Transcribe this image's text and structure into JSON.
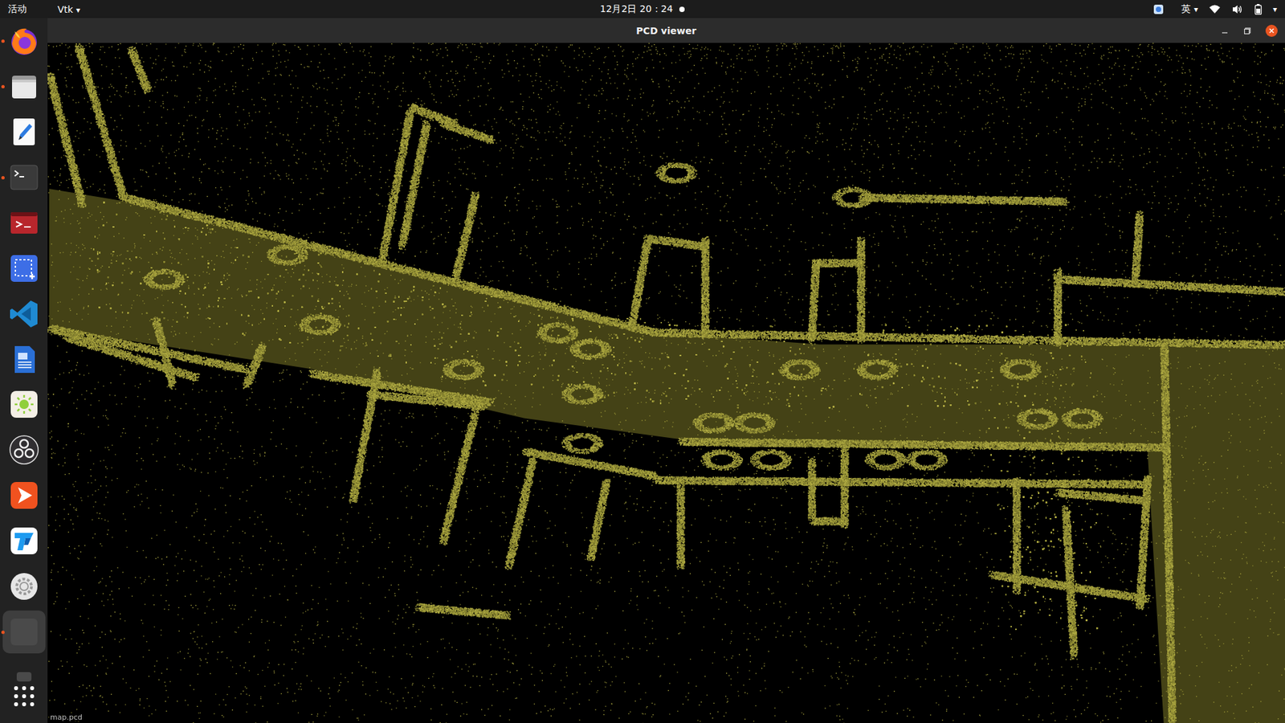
{
  "top_bar": {
    "activities": "活动",
    "app_menu": {
      "label": "Vtk",
      "arrow": "▾"
    },
    "clock": "12月2日 20：24",
    "notification": true,
    "input_method": {
      "label": "英",
      "arrow": "▾"
    },
    "system_arrow": "▾"
  },
  "dock": {
    "items": [
      {
        "kind": "firefox",
        "running": true,
        "selected": false
      },
      {
        "kind": "files",
        "running": true,
        "selected": false
      },
      {
        "kind": "editor",
        "running": false,
        "selected": false
      },
      {
        "kind": "terminal",
        "running": true,
        "selected": false
      },
      {
        "kind": "remote",
        "running": false,
        "selected": false
      },
      {
        "kind": "screenshot",
        "running": false,
        "selected": false
      },
      {
        "kind": "vscode",
        "running": false,
        "selected": false
      },
      {
        "kind": "document",
        "running": false,
        "selected": false
      },
      {
        "kind": "brightness",
        "running": false,
        "selected": false
      },
      {
        "kind": "obs",
        "running": false,
        "selected": false
      },
      {
        "kind": "player",
        "running": false,
        "selected": false
      },
      {
        "kind": "lark",
        "running": false,
        "selected": false
      },
      {
        "kind": "settings",
        "running": false,
        "selected": false
      },
      {
        "kind": "viewer",
        "running": true,
        "selected": true
      },
      {
        "kind": "partial",
        "running": false,
        "selected": false
      }
    ]
  },
  "window": {
    "title": "PCD viewer"
  },
  "viewer": {
    "status_text": "map.pcd"
  }
}
